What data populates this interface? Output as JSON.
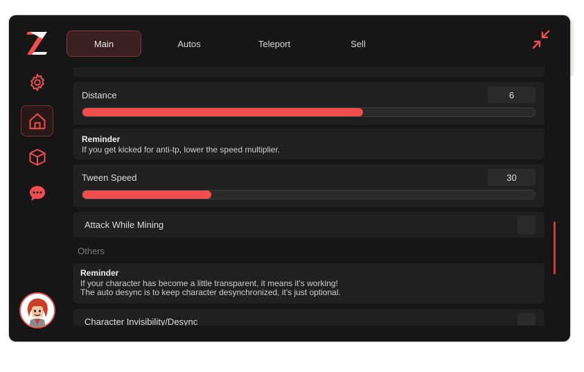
{
  "tabs": [
    {
      "label": "Main",
      "active": true
    },
    {
      "label": "Autos",
      "active": false
    },
    {
      "label": "Teleport",
      "active": false
    },
    {
      "label": "Sell",
      "active": false
    }
  ],
  "sidebar": {
    "items": [
      {
        "icon": "gear-icon"
      },
      {
        "icon": "home-icon",
        "active": true
      },
      {
        "icon": "cube-icon"
      },
      {
        "icon": "chat-icon"
      }
    ]
  },
  "sliders": {
    "distance": {
      "label": "Distance",
      "value": "6",
      "fill_fraction": 0.62
    },
    "tween_speed": {
      "label": "Tween Speed",
      "value": "30",
      "fill_fraction": 0.285
    }
  },
  "reminder1": {
    "title": "Reminder",
    "text": "If you get kicked for anti-tp, lower the speed multiplier."
  },
  "toggles": {
    "attack_while_mining": {
      "label": "Attack While Mining",
      "on": false
    },
    "character_invisibility": {
      "label": "Character Invisibility/Desync",
      "on": false
    }
  },
  "section_others": "Others",
  "reminder2": {
    "title": "Reminder",
    "line1": "If your character has become a little transparent, it means it's working!",
    "line2": "The auto desync is to keep character desynchronized, it's just optional."
  },
  "colors": {
    "accent": "#f14f4f",
    "window": "#161616",
    "card": "#202020"
  }
}
